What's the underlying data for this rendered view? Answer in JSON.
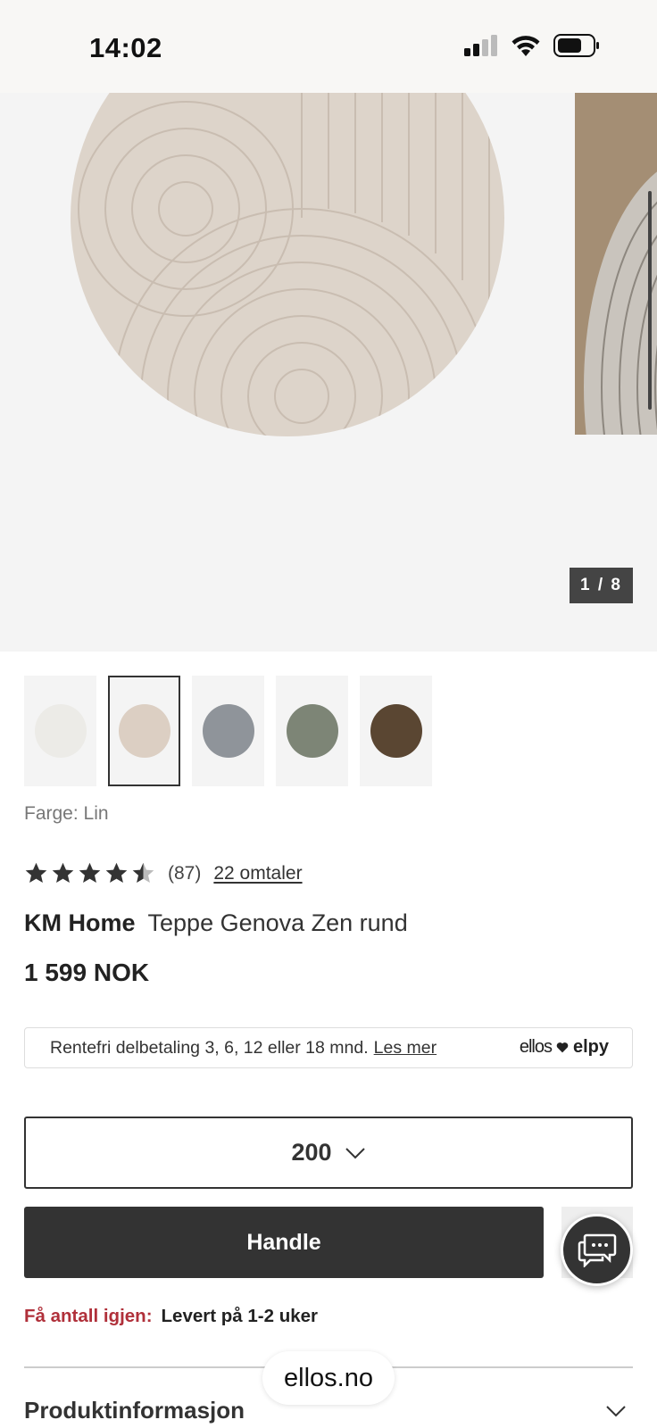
{
  "status_bar": {
    "time": "14:02"
  },
  "gallery": {
    "counter": "1 / 8"
  },
  "swatches": [
    {
      "name": "white",
      "color": "#ecebe7",
      "selected": false
    },
    {
      "name": "lin",
      "color": "#dccfc3",
      "selected": true
    },
    {
      "name": "grey",
      "color": "#8f949a",
      "selected": false
    },
    {
      "name": "green",
      "color": "#7d8576",
      "selected": false
    },
    {
      "name": "brown",
      "color": "#5a4632",
      "selected": false
    }
  ],
  "color_label": "Farge: Lin",
  "rating": {
    "score": 4.5,
    "count": "(87)",
    "reviews_link": "22 omtaler"
  },
  "product": {
    "brand": "KM Home",
    "name": "Teppe Genova Zen rund",
    "price": "1 599 NOK"
  },
  "installment": {
    "text": "Rentefri delbetaling 3, 6, 12 eller 18 mnd.",
    "link": "Les mer",
    "logo_left": "ellos",
    "logo_right": "elpy"
  },
  "size_select": {
    "value": "200"
  },
  "buy_button": {
    "label": "Handle"
  },
  "stock": {
    "warning": "Få antall igjen:",
    "delivery": "Levert på 1-2 uker"
  },
  "product_info": {
    "heading": "Produktinformasjon"
  },
  "browser": {
    "url": "ellos.no"
  },
  "colors": {
    "accent": "#333333",
    "warning": "#b0303a"
  }
}
